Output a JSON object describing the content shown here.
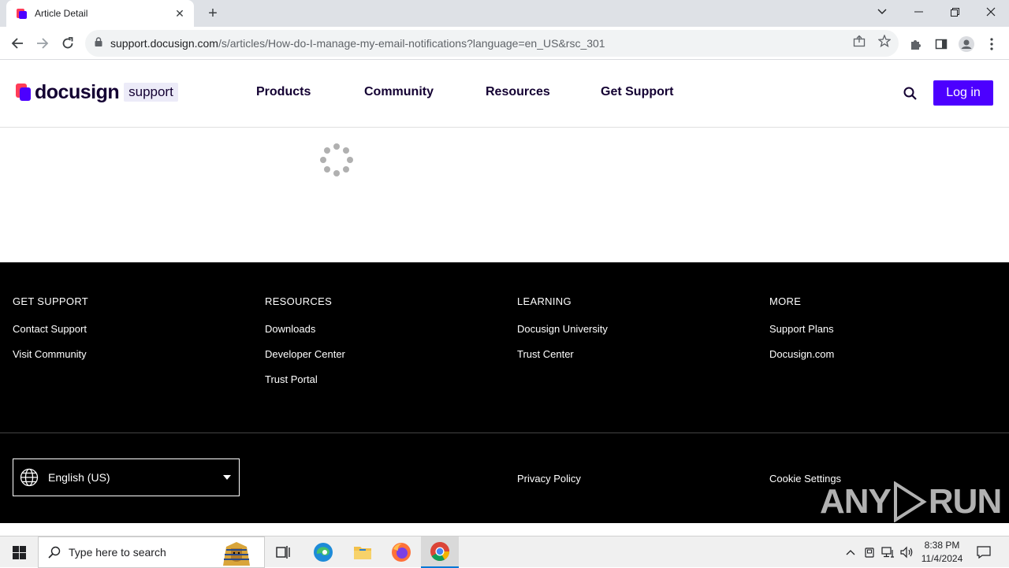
{
  "browser": {
    "tab_title": "Article Detail",
    "url_host": "support.docusign.com",
    "url_path": "/s/articles/How-do-I-manage-my-email-notifications?language=en_US&rsc_301"
  },
  "header": {
    "logo_text": "docusign",
    "logo_sub": "support",
    "nav": [
      "Products",
      "Community",
      "Resources",
      "Get Support"
    ],
    "login_label": "Log in"
  },
  "footer": {
    "columns": [
      {
        "heading": "GET SUPPORT",
        "links": [
          "Contact Support",
          "Visit Community"
        ]
      },
      {
        "heading": "RESOURCES",
        "links": [
          "Downloads",
          "Developer Center",
          "Trust Portal"
        ]
      },
      {
        "heading": "LEARNING",
        "links": [
          "Docusign University",
          "Trust Center"
        ]
      },
      {
        "heading": "MORE",
        "links": [
          "Support Plans",
          "Docusign.com"
        ]
      }
    ],
    "language": "English (US)",
    "privacy_label": "Privacy Policy",
    "cookie_label": "Cookie Settings",
    "watermark_left": "ANY",
    "watermark_right": "RUN"
  },
  "taskbar": {
    "search_placeholder": "Type here to search",
    "time": "8:38 PM",
    "date": "11/4/2024"
  },
  "colors": {
    "brand_purple": "#4c00ff",
    "brand_red": "#ff3c58",
    "footer_bg": "#000000"
  }
}
